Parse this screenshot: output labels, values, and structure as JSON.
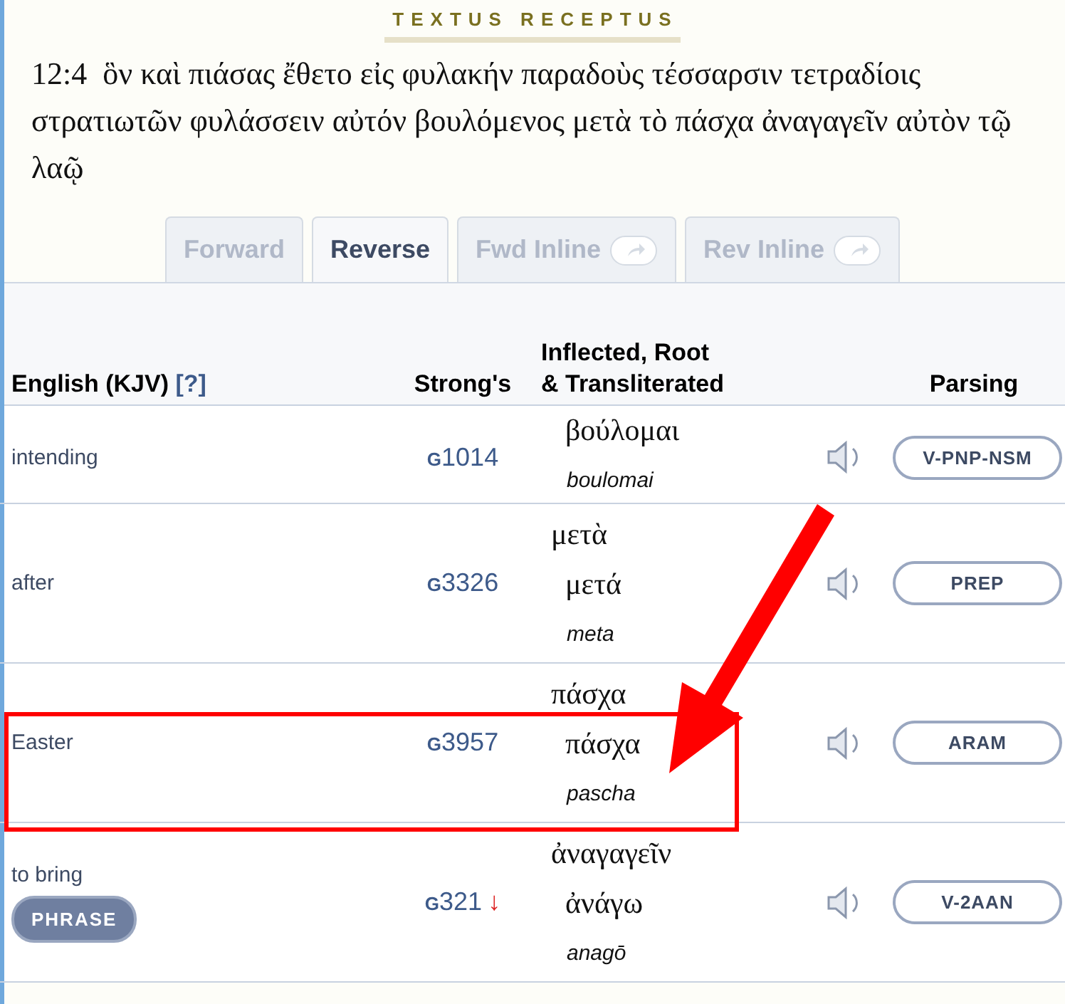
{
  "section_title": "TEXTUS RECEPTUS",
  "verse": {
    "reference": "12:4",
    "text": "ὃν καὶ πιάσας ἔθετο εἰς φυλακήν παραδοὺς τέσσαρσιν τετραδίοις στρατιωτῶν φυλάσσειν αὐτόν βουλόμενος μετὰ τὸ πάσχα ἀναγαγεῖν αὐτὸν τῷ λαῷ"
  },
  "tabs": [
    {
      "label": "Forward",
      "selected": false,
      "share": false
    },
    {
      "label": "Reverse",
      "selected": true,
      "share": false
    },
    {
      "label": "Fwd Inline",
      "selected": false,
      "share": true
    },
    {
      "label": "Rev Inline",
      "selected": false,
      "share": true
    }
  ],
  "table": {
    "columns": [
      {
        "label": "English (KJV)",
        "help": "[?]"
      },
      {
        "label": "Strong's"
      },
      {
        "label": "Inflected, Root & Transliterated"
      },
      {
        "label": "Parsing"
      }
    ],
    "rows": [
      {
        "english": "intending",
        "strongs_prefix": "G",
        "strongs_number": "1014",
        "root": "βούλομαι",
        "translit": "boulomai",
        "parsing": "V-PNP-NSM",
        "highlighted": false
      },
      {
        "english": "after",
        "strongs_prefix": "G",
        "strongs_number": "3326",
        "inflected": "μετὰ",
        "root": "μετά",
        "translit": "meta",
        "parsing": "PREP",
        "highlighted": false
      },
      {
        "english": "Easter",
        "strongs_prefix": "G",
        "strongs_number": "3957",
        "inflected": "πάσχα",
        "root": "πάσχα",
        "translit": "pascha",
        "parsing": "ARAM",
        "highlighted": true
      },
      {
        "english": "to bring",
        "badge": "PHRASE",
        "strongs_prefix": "G",
        "strongs_number": "321",
        "strongs_mark": "↓",
        "inflected": "ἀναγαγεῖν",
        "root": "ἀνάγω",
        "translit": "anagō",
        "parsing": "V-2AAN",
        "highlighted": false
      }
    ]
  }
}
